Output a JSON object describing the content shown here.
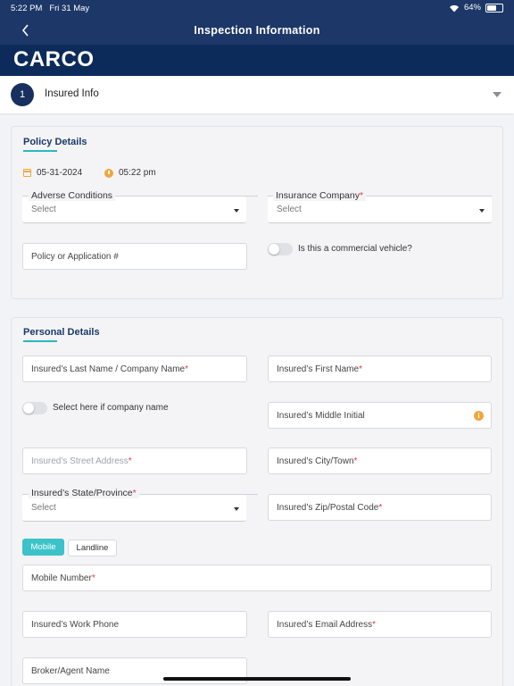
{
  "status": {
    "time": "5:22 PM",
    "date": "Fri 31 May",
    "battery": "64%",
    "battery_level": 0.64
  },
  "nav": {
    "title": "Inspection Information"
  },
  "brand": {
    "logo_text": "CARCO"
  },
  "step": {
    "number": "1",
    "label": "Insured Info"
  },
  "policy": {
    "title": "Policy Details",
    "date": "05-31-2024",
    "time": "05:22 pm",
    "adverse_label": "Adverse Conditions",
    "adverse_value": "Select",
    "insurance_label": "Insurance Company",
    "insurance_value": "Select",
    "policy_placeholder": "Policy or Application #",
    "commercial_label": "Is this a commercial vehicle?"
  },
  "personal": {
    "title": "Personal Details",
    "last_name": "Insured’s Last Name / Company Name",
    "first_name": "Insured’s First Name",
    "company_toggle": "Select here if company name",
    "middle_initial": "Insured’s Middle Initial",
    "street": "Insured’s Street Address",
    "city": "Insured’s City/Town",
    "state_label": "Insured’s State/Province",
    "state_value": "Select",
    "zip": "Insured’s Zip/Postal Code",
    "phone_types": [
      "Mobile",
      "Landline"
    ],
    "mobile": "Mobile Number",
    "work_phone": "Insured’s Work Phone",
    "email": "Insured’s Email Address",
    "broker": "Broker/Agent Name",
    "required_mark": "*",
    "info_mark": "i"
  }
}
